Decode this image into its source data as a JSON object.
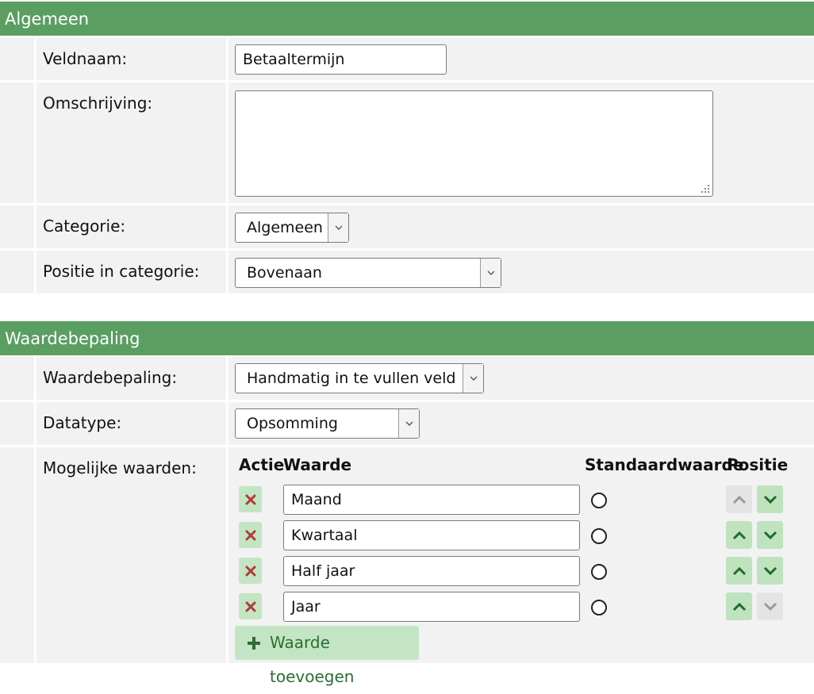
{
  "sections": {
    "general": {
      "title": "Algemeen"
    },
    "value": {
      "title": "Waardebepaling"
    }
  },
  "fields": {
    "field_name": {
      "label": "Veldnaam:",
      "value": "Betaaltermijn"
    },
    "description": {
      "label": "Omschrijving:",
      "value": ""
    },
    "category": {
      "label": "Categorie:",
      "selected": "Algemeen"
    },
    "position_in_category": {
      "label": "Positie in categorie:",
      "selected": "Bovenaan"
    },
    "value_determination": {
      "label": "Waardebepaling:",
      "selected": "Handmatig in te vullen veld"
    },
    "datatype": {
      "label": "Datatype:",
      "selected": "Opsomming"
    },
    "possible_values": {
      "label": "Mogelijke waarden:"
    }
  },
  "values_table": {
    "headers": {
      "action": "Actie",
      "value": "Waarde",
      "default": "Standaardwaarde",
      "position": "Positie"
    },
    "rows": [
      {
        "value": "Maand",
        "is_default": false,
        "up_enabled": false,
        "down_enabled": true
      },
      {
        "value": "Kwartaal",
        "is_default": false,
        "up_enabled": true,
        "down_enabled": true
      },
      {
        "value": "Half jaar",
        "is_default": false,
        "up_enabled": true,
        "down_enabled": true
      },
      {
        "value": "Jaar",
        "is_default": false,
        "up_enabled": true,
        "down_enabled": false
      }
    ],
    "add_button_label": "Waarde toevoegen"
  },
  "icons": {
    "delete": "close-icon",
    "move_up": "chevron-up-icon",
    "move_down": "chevron-down-icon",
    "add": "plus-icon",
    "dropdown": "chevron-down-icon"
  },
  "colors": {
    "header_bg": "#5a9e62",
    "button_green_bg": "#c3e5c3",
    "delete_red": "#b23a3a",
    "arrow_green": "#1f6b2a",
    "disabled_grey": "#e4e4e4"
  }
}
